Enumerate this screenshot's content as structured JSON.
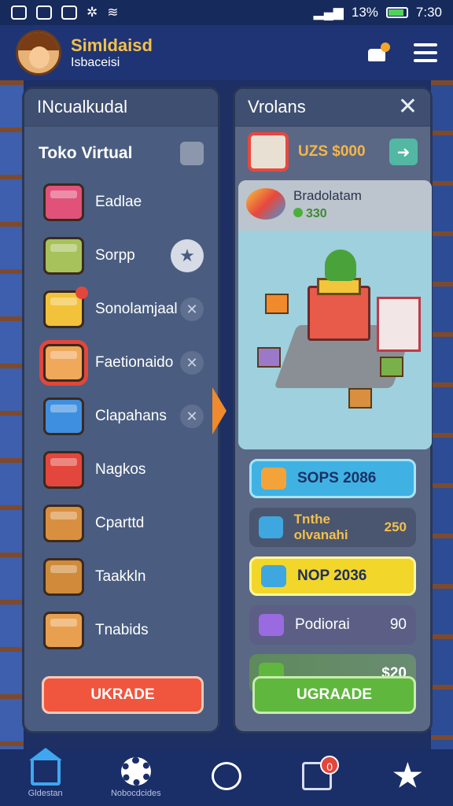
{
  "status": {
    "battery": "13%",
    "time": "7:30"
  },
  "header": {
    "title": "Simldaisd",
    "subtitle": "Isbaceisi"
  },
  "left_panel": {
    "title": "INcualkudal",
    "toko_label": "Toko Virtual",
    "items": [
      {
        "label": "Eadlae",
        "color": "#e0527a",
        "action": ""
      },
      {
        "label": "Sorpp",
        "color": "#a7c25a",
        "action": "★"
      },
      {
        "label": "Sonolamjaal",
        "color": "#f2c23a",
        "action": "✕"
      },
      {
        "label": "Faetionaido",
        "color": "#f0a85a",
        "action": "✕"
      },
      {
        "label": "Clapahans",
        "color": "#3f8fe0",
        "action": "✕"
      },
      {
        "label": "Nagkos",
        "color": "#e2463c",
        "action": ""
      },
      {
        "label": "Cparttd",
        "color": "#d89040",
        "action": ""
      },
      {
        "label": "Taakkln",
        "color": "#d08a3a",
        "action": ""
      },
      {
        "label": "Tnabids",
        "color": "#e8a050",
        "action": ""
      }
    ],
    "upgrade_label": "UKRADE"
  },
  "right_panel": {
    "title": "Vrolans",
    "price": "UZS $000",
    "card": {
      "name": "Bradolatam",
      "price": "330"
    },
    "pills": [
      {
        "label": "SOPS 2086",
        "num": "",
        "style": "blue"
      },
      {
        "label": "Tnthe olvanahi",
        "num": "250",
        "style": "dark"
      },
      {
        "label": "NOP 2036",
        "num": "",
        "style": "yellow"
      },
      {
        "label": "Podiorai",
        "num": "90",
        "style": "purple"
      },
      {
        "label": "",
        "num": "$20",
        "style": "gr"
      }
    ],
    "upgrade_label": "UGRAADE"
  },
  "nav": {
    "items": [
      {
        "label": "Gldestan",
        "icon": "home-icon"
      },
      {
        "label": "Nobocdcides",
        "icon": "gear-icon"
      },
      {
        "label": "",
        "icon": "compass-icon"
      },
      {
        "label": "",
        "icon": "box-icon",
        "badge": "0"
      },
      {
        "label": "",
        "icon": "star-icon"
      }
    ]
  }
}
